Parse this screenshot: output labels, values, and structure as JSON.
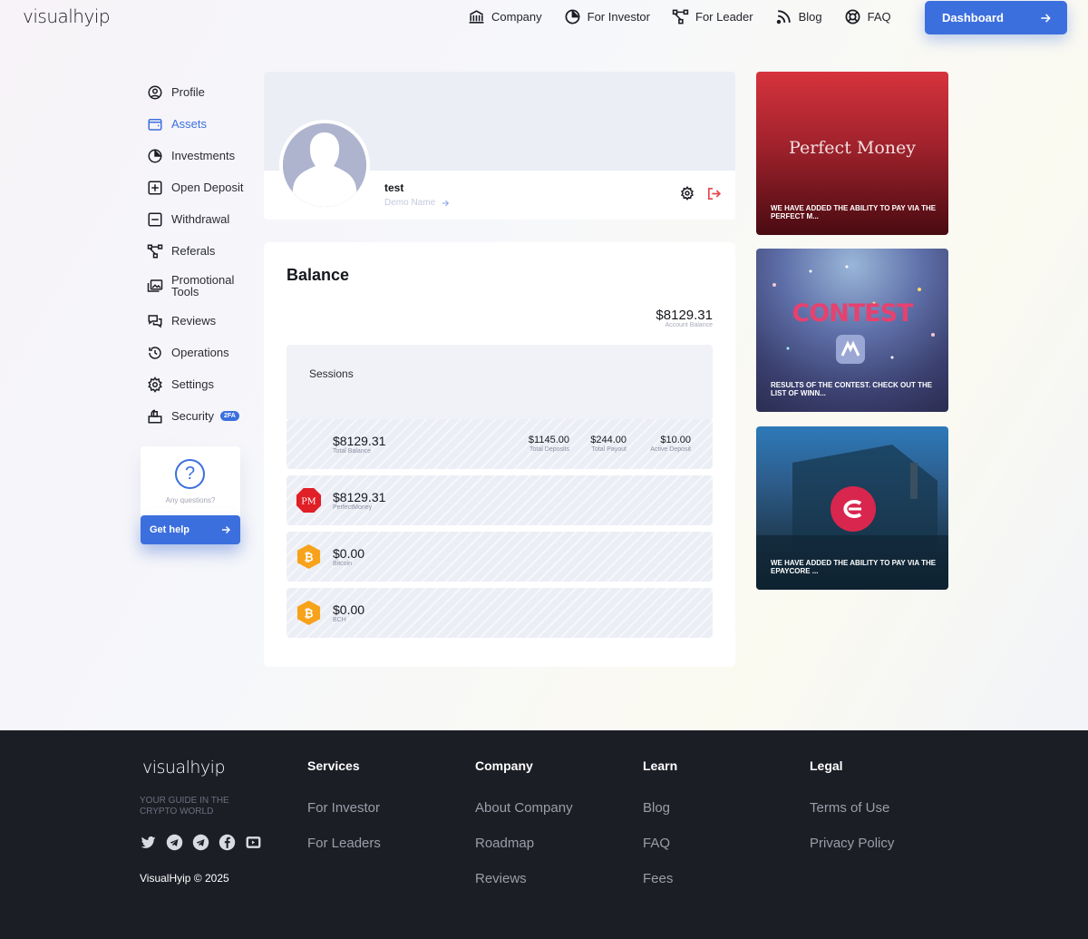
{
  "header": {
    "logo": "visualhyip",
    "nav": [
      {
        "label": "Company",
        "icon": "bank-icon"
      },
      {
        "label": "For Investor",
        "icon": "pie-chart-icon"
      },
      {
        "label": "For Leader",
        "icon": "network-icon"
      },
      {
        "label": "Blog",
        "icon": "rss-icon"
      },
      {
        "label": "FAQ",
        "icon": "lifebuoy-icon"
      }
    ],
    "dashboard_label": "Dashboard"
  },
  "sidebar": {
    "items": [
      {
        "label": "Profile",
        "icon": "user-circle-icon"
      },
      {
        "label": "Assets",
        "icon": "wallet-icon"
      },
      {
        "label": "Investments",
        "icon": "pie-chart-icon"
      },
      {
        "label": "Open Deposit",
        "icon": "plus-square-icon"
      },
      {
        "label": "Withdrawal",
        "icon": "minus-square-icon"
      },
      {
        "label": "Referals",
        "icon": "network-icon"
      },
      {
        "label": "Promotional Tools",
        "icon": "images-icon"
      },
      {
        "label": "Reviews",
        "icon": "chat-icon"
      },
      {
        "label": "Operations",
        "icon": "history-icon"
      },
      {
        "label": "Settings",
        "icon": "gear-icon"
      },
      {
        "label": "Security",
        "icon": "lock-icon",
        "badge": "2FA"
      }
    ],
    "active": "Assets",
    "help": {
      "text": "Any questions?",
      "button": "Get help"
    }
  },
  "profile": {
    "username": "test",
    "link": "Demo Name"
  },
  "balance": {
    "title": "Balance",
    "account_amount": "$8129.31",
    "account_label": "Account Balance",
    "sessions_label": "Sessions",
    "total": {
      "amount": "$8129.31",
      "label": "Total Balance",
      "stats": [
        {
          "value": "$1145.00",
          "label": "Total Deposits"
        },
        {
          "value": "$244.00",
          "label": "Total Payout"
        },
        {
          "value": "$10.00",
          "label": "Active Deposit"
        }
      ]
    },
    "wallets": [
      {
        "amount": "$8129.31",
        "label": "PerfectMoney",
        "icon": "perfect-money-icon",
        "mark": "PM"
      },
      {
        "amount": "$0.00",
        "label": "Bitcoin",
        "icon": "bitcoin-icon",
        "mark": "₿"
      },
      {
        "amount": "$0.00",
        "label": "BCH",
        "icon": "bitcoin-cash-icon",
        "mark": "₿"
      }
    ]
  },
  "promos": [
    {
      "title": "Perfect Money",
      "caption": "WE HAVE ADDED THE ABILITY TO PAY VIA THE PERFECT M..."
    },
    {
      "title": "CONTEST",
      "caption": "RESULTS OF THE CONTEST. CHECK OUT THE LIST OF WINN..."
    },
    {
      "title": "",
      "caption": "WE HAVE ADDED THE ABILITY TO PAY VIA THE EPAYCORE ..."
    }
  ],
  "footer": {
    "logo": "visualhyip",
    "tagline": "YOUR GUIDE IN THE CRYPTO WORLD",
    "copyright": "VisualHyip © 2025",
    "social": [
      "twitter-icon",
      "telegram-icon",
      "telegram-icon",
      "facebook-icon",
      "youtube-icon"
    ],
    "columns": [
      {
        "title": "Services",
        "links": [
          "For Investor",
          "For Leaders"
        ]
      },
      {
        "title": "Company",
        "links": [
          "About Company",
          "Roadmap",
          "Reviews"
        ]
      },
      {
        "title": "Learn",
        "links": [
          "Blog",
          "FAQ",
          "Fees"
        ]
      },
      {
        "title": "Legal",
        "links": [
          "Terms of Use",
          "Privacy Policy"
        ]
      }
    ]
  },
  "colors": {
    "accent": "#3c6fde",
    "footer_bg": "#1c1e26",
    "pm_red": "#e01f26",
    "btc_orange": "#f7a21b"
  }
}
